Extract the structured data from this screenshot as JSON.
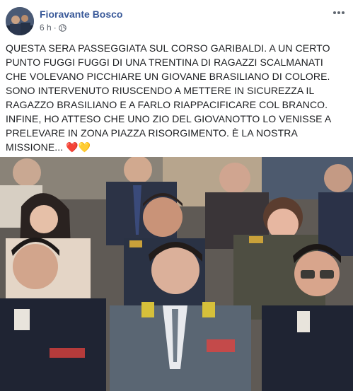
{
  "post": {
    "author": "Fioravante Bosco",
    "time": "6 h",
    "privacy_icon": "globe-icon",
    "more_icon": "more-dots-icon",
    "text": "QUESTA SERA PASSEGGIATA SUL CORSO GARIBALDI. A UN CERTO PUNTO FUGGI FUGGI DI UNA TRENTINA DI RAGAZZI SCALMANATI CHE VOLEVANO PICCHIARE UN GIOVANE BRASILIANO DI COLORE. SONO INTERVENUTO RIUSCENDO A METTERE IN SICUREZZA IL RAGAZZO BRASILIANO E A FARLO RIAPPACIFICARE COL BRANCO. INFINE, HO ATTESO CHE UNO ZIO DEL GIOVANOTTO LO VENISSE A PRELEVARE IN ZONA PIAZZA RISORGIMENTO. È LA NOSTRA MISSIONE... ❤️💛"
  },
  "colors": {
    "author": "#385898",
    "meta": "#616770"
  }
}
